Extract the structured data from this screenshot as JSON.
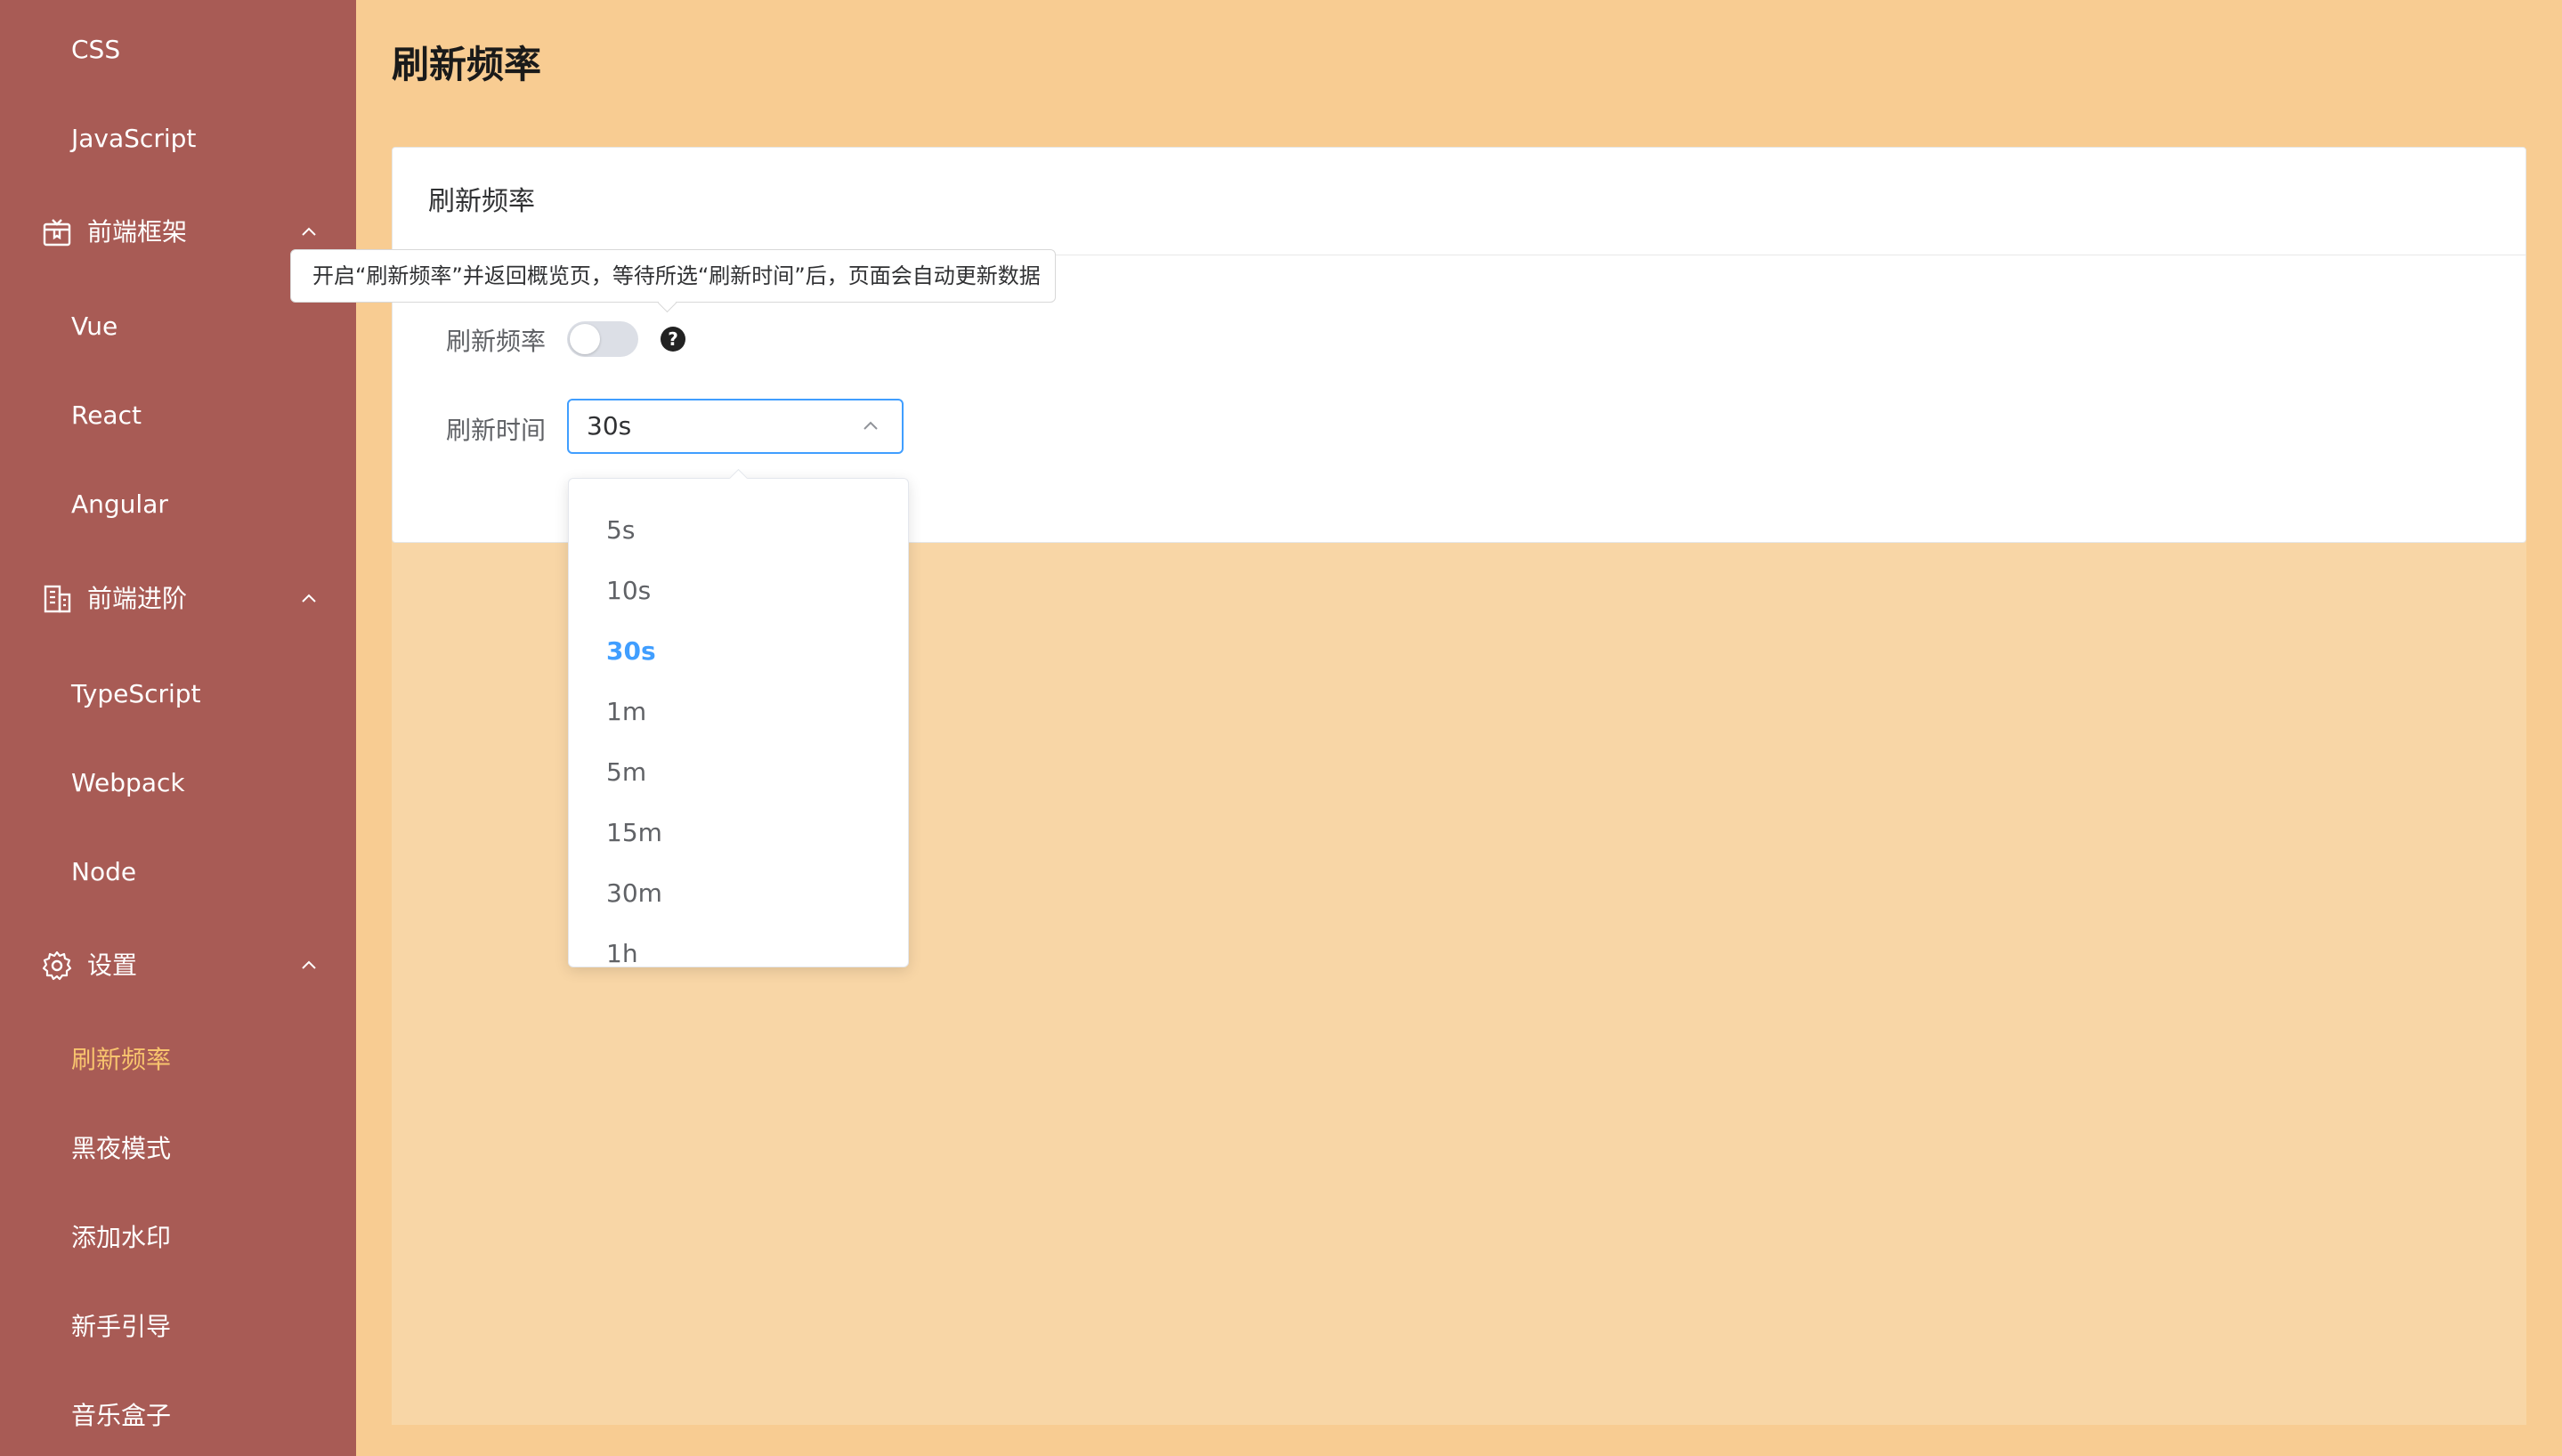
{
  "sidebar": {
    "items_top": [
      {
        "label": "CSS"
      },
      {
        "label": "JavaScript"
      }
    ],
    "groups": [
      {
        "label": "前端框架",
        "icon": "box-icon",
        "items": [
          {
            "label": "Vue"
          },
          {
            "label": "React"
          },
          {
            "label": "Angular"
          }
        ]
      },
      {
        "label": "前端进阶",
        "icon": "building-icon",
        "items": [
          {
            "label": "TypeScript"
          },
          {
            "label": "Webpack"
          },
          {
            "label": "Node"
          }
        ]
      },
      {
        "label": "设置",
        "icon": "gear-icon",
        "items": [
          {
            "label": "刷新频率",
            "active": true
          },
          {
            "label": "黑夜模式"
          },
          {
            "label": "添加水印"
          },
          {
            "label": "新手引导"
          },
          {
            "label": "音乐盒子"
          }
        ]
      }
    ]
  },
  "page": {
    "title": "刷新频率"
  },
  "card": {
    "title": "刷新频率",
    "refresh_label": "刷新频率",
    "refresh_enabled": false,
    "help_icon": "?",
    "time_label": "刷新时间",
    "time_value": "30s"
  },
  "tooltip": {
    "text": "开启“刷新频率”并返回概览页，等待所选“刷新时间”后，页面会自动更新数据"
  },
  "dropdown": {
    "options": [
      "5s",
      "10s",
      "30s",
      "1m",
      "5m",
      "15m",
      "30m",
      "1h"
    ],
    "selected": "30s"
  },
  "colors": {
    "sidebar_bg": "#a85b55",
    "page_bg": "#f8cc92",
    "active_menu": "#f8c46e",
    "accent": "#409eff"
  }
}
